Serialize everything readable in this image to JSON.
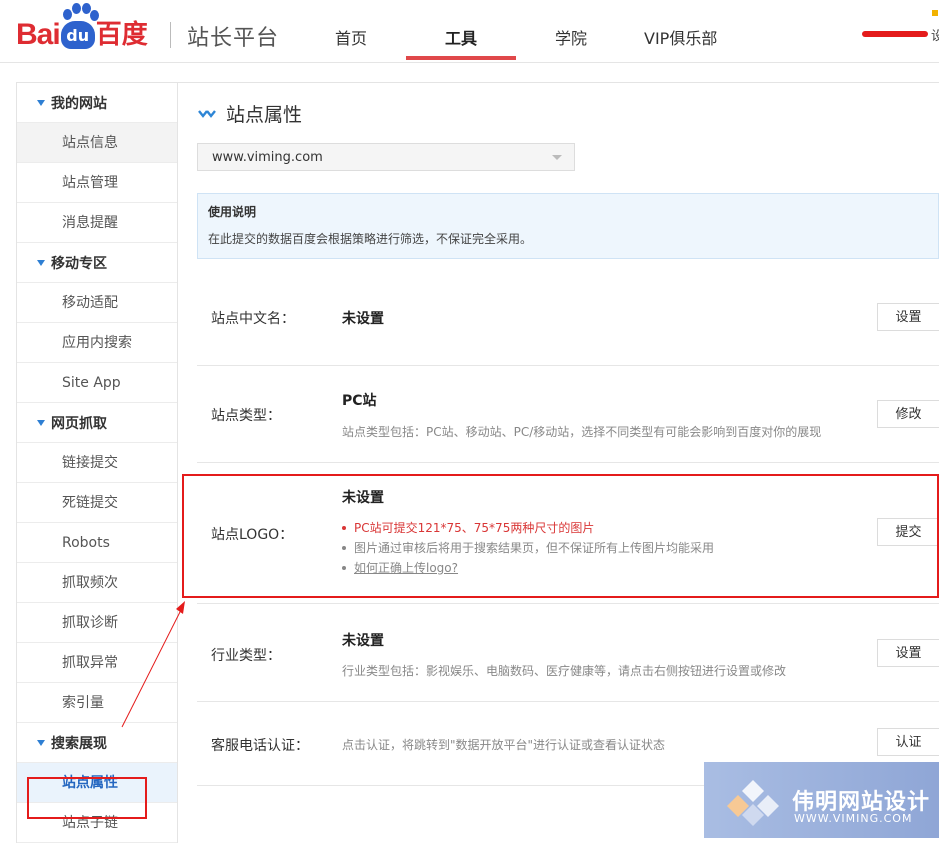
{
  "brand": {
    "bai": "Bai",
    "du": "du",
    "cn": "百度",
    "site_name": "站长平台"
  },
  "nav": {
    "items": [
      {
        "label": "首页"
      },
      {
        "label": "工具"
      },
      {
        "label": "学院"
      },
      {
        "label": "VIP俱乐部"
      }
    ],
    "active": "工具",
    "edge_text": "设"
  },
  "sidebar": {
    "sections": [
      {
        "title": "我的网站",
        "items": [
          "站点信息",
          "站点管理",
          "消息提醒"
        ]
      },
      {
        "title": "移动专区",
        "items": [
          "移动适配",
          "应用内搜索",
          "Site App"
        ]
      },
      {
        "title": "网页抓取",
        "items": [
          "链接提交",
          "死链提交",
          "Robots",
          "抓取频次",
          "抓取诊断",
          "抓取异常",
          "索引量"
        ]
      },
      {
        "title": "搜索展现",
        "items": [
          "站点属性",
          "站点子链"
        ]
      }
    ],
    "highlighted": "站点信息",
    "selected": "站点属性"
  },
  "main": {
    "title": "站点属性",
    "site_select": {
      "value": "www.viming.com"
    },
    "notice": {
      "title": "使用说明",
      "text": "在此提交的数据百度会根据策略进行筛选，不保证完全采用。"
    },
    "rows": [
      {
        "label": "站点中文名：",
        "value": "未设置",
        "button": "设置"
      },
      {
        "label": "站点类型：",
        "value": "PC站",
        "desc": "站点类型包括：PC站、移动站、PC/移动站，选择不同类型有可能会影响到百度对你的展现",
        "button": "修改"
      },
      {
        "label": "站点LOGO：",
        "value": "未设置",
        "bullets": [
          "PC站可提交121*75、75*75两种尺寸的图片",
          "图片通过审核后将用于搜索结果页，但不保证所有上传图片均能采用",
          "如何正确上传logo?"
        ],
        "button": "提交"
      },
      {
        "label": "行业类型：",
        "value": "未设置",
        "desc": "行业类型包括：影视娱乐、电脑数码、医疗健康等，请点击右侧按钮进行设置或修改",
        "button": "设置"
      },
      {
        "label": "客服电话认证：",
        "desc": "点击认证，将跳转到\"数据开放平台\"进行认证或查看认证状态",
        "button": "认证"
      }
    ]
  },
  "watermark": {
    "cn": "伟明网站设计",
    "en": "WWW.VIMING.COM"
  },
  "colors": {
    "brand_red": "#de2c32",
    "brand_blue": "#2e62cd",
    "accent_red": "#e41b1b",
    "link_blue": "#2466c0"
  }
}
